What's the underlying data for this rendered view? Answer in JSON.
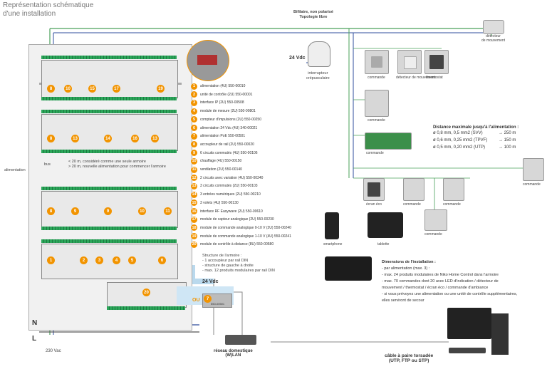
{
  "title": [
    "Représentation schématique",
    "d'une installation"
  ],
  "bus_topology": [
    "Bifilaire, non polarisé",
    "Topologie libre"
  ],
  "power_label": "24 Vdc",
  "power_label_2": "24 Vdc",
  "twilight_switch": [
    "interrupteur",
    "crépusculaire"
  ],
  "motion_detector": [
    "détecteur",
    "de mouvement"
  ],
  "top_devices": [
    "commande",
    "détecteur de mouvement",
    "thermostat"
  ],
  "commande_labels": [
    "commande",
    "commande",
    "commande",
    "commande",
    "commande",
    "commande"
  ],
  "ecran_eco": "écran éco",
  "smartphone": "smartphone",
  "tablette": "tablette",
  "distance": {
    "title": "Distance maximale jusqu'à l'alimentation :",
    "rows": [
      {
        "spec": "ø 0,8 mm, 0,5 mm2 (SVV)",
        "dist": "250 m"
      },
      {
        "spec": "ø 0,6 mm, 0,25 mm2 (TPVF)",
        "dist": "150 m"
      },
      {
        "spec": "ø 0,5 mm, 0,20 mm2 (UTP)",
        "dist": "100 m"
      }
    ]
  },
  "dimensions": {
    "title": "Dimensions de l'installation :",
    "lines": [
      "- par alimentation (max. 3) :",
      "- max. 24 produits modulaires de Niko Home Control dans l'armoire",
      "- max. 70 commandes dont 20 avec LED d'indication / détecteur de",
      "mouvement / thermostat / écran éco / commande d'ambiance",
      "- si vous prévoyez une alimentation ou une unité de contrôle supplémentaires,",
      "elles serviront de secour"
    ]
  },
  "legend": [
    {
      "n": "1",
      "text": "alimentation (4U) 550-00010"
    },
    {
      "n": "2",
      "text": "unité de contrôle (2U) 550-00001"
    },
    {
      "n": "3",
      "text": "interface IP (2U) 550-00508"
    },
    {
      "n": "4",
      "text": "module de mesure (2U) 550-00801"
    },
    {
      "n": "5",
      "text": "compteur d'impulsions (2U) 550-00250"
    },
    {
      "n": "6",
      "text": "alimentation 24 Vdc (4U) 340-00021"
    },
    {
      "n": "7",
      "text": "alimentation PoE 550-00501"
    },
    {
      "n": "8",
      "text": "accoupleur de rail (2U) 550-00020"
    },
    {
      "n": "9",
      "text": "6 circuits commutés (4U) 550-00106"
    },
    {
      "n": "10",
      "text": "chauffage (4U) 550-00150"
    },
    {
      "n": "11",
      "text": "ventilation (2U) 550-00140"
    },
    {
      "n": "12",
      "text": "2 circuits avec variation (4U) 550-00340"
    },
    {
      "n": "13",
      "text": "3 circuits commutés (2U) 550-00103"
    },
    {
      "n": "14",
      "text": "3 entrées numériques (2U) 550-00210"
    },
    {
      "n": "15",
      "text": "3 volets (4U) 550-00130"
    },
    {
      "n": "16",
      "text": "interface RF Easywave (2U) 550-00610"
    },
    {
      "n": "17",
      "text": "module de capteur analogique (2U) 550-00230"
    },
    {
      "n": "18",
      "text": "module de commande analogique 0-10 V (2U) 550-00240"
    },
    {
      "n": "19",
      "text": "module de commande analogique 1-10 V (4U) 550-00241"
    },
    {
      "n": "20",
      "text": "module de contrôle à distance (8U) 550-00580"
    }
  ],
  "armoire": [
    "Structure de l'armoire :",
    "- 1 accoupleur par rail DIN",
    "- structure de gauche à droite",
    "- max. 12 produits modulaires par rail DIN"
  ],
  "bus_note": [
    "< 20 m, considéré comme une seule armoire",
    "> 20 m, nouvelle alimentation pour commencer l'armoire"
  ],
  "bus": "bus",
  "alimentation": "alimentation",
  "ou": "OU",
  "poe_part": "550-00501",
  "n_label": "N",
  "l_label": "L",
  "mains": "230 Vac",
  "lan": [
    "réseau domestique",
    "(W)LAN"
  ],
  "cable": [
    "câble à paire torsadée",
    "(UTP, FTP ou STP)"
  ],
  "rail_badges": {
    "r1": [
      "8",
      "10",
      "15",
      "17",
      "19"
    ],
    "r2": [
      "8",
      "13",
      "14",
      "16",
      "13"
    ],
    "r3": [
      "8",
      "9",
      "9",
      "10",
      "11"
    ],
    "r4": [
      "1",
      "2",
      "3",
      "4",
      "5",
      "6"
    ],
    "r5": [
      "20"
    ]
  },
  "colors": {
    "accent": "#f29400",
    "bus": "#4aa05a",
    "power": "#2f4c9c",
    "lan": "#9cc9e6"
  }
}
